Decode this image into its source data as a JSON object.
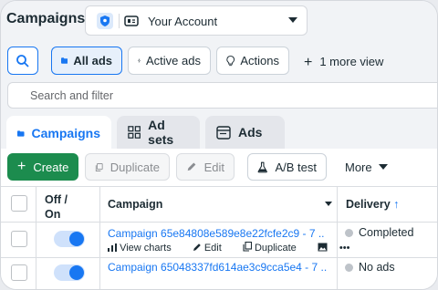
{
  "header": {
    "title": "Campaigns",
    "account": {
      "label": "Your Account"
    }
  },
  "filters": {
    "all_ads": "All ads",
    "active_ads": "Active ads",
    "actions": "Actions",
    "more_view": "1 more view"
  },
  "search": {
    "placeholder": "Search and filter"
  },
  "tabs": [
    {
      "label": "Campaigns",
      "active": true
    },
    {
      "label": "Ad sets",
      "active": false
    },
    {
      "label": "Ads",
      "active": false
    }
  ],
  "toolbar": {
    "create": "Create",
    "duplicate": "Duplicate",
    "edit": "Edit",
    "ab_test": "A/B test",
    "more": "More"
  },
  "table": {
    "columns": {
      "off_on": "Off / On",
      "campaign": "Campaign",
      "delivery": "Delivery"
    },
    "rows": [
      {
        "name": "Campaign 65e84808e589e8e22fcfe2c9 - 7 ..",
        "enabled": true,
        "delivery": "Completed",
        "actions": {
          "view_charts": "View charts",
          "edit": "Edit",
          "duplicate": "Duplicate",
          "more": "•••"
        }
      },
      {
        "name": "Campaign 65048337fd614ae3c9cca5e4 - 7 ..",
        "enabled": true,
        "delivery": "No ads"
      }
    ]
  },
  "colors": {
    "accent": "#1877f2",
    "create_green": "#1c8c4e",
    "status_dot": "#bec3c9"
  }
}
